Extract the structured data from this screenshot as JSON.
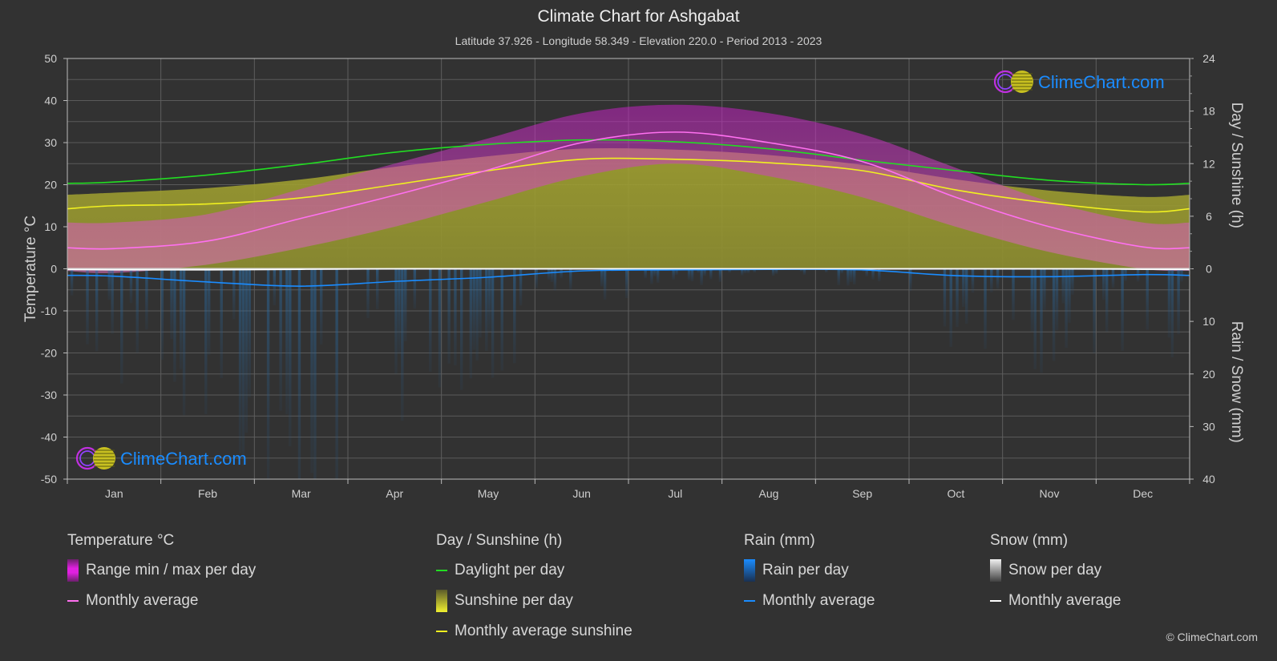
{
  "header": {
    "title": "Climate Chart for Ashgabat",
    "subtitle": "Latitude 37.926 - Longitude 58.349 - Elevation 220.0 - Period 2013 - 2023"
  },
  "watermark": {
    "text": "ClimeChart.com"
  },
  "copyright": "© ClimeChart.com",
  "legend": {
    "temperature": {
      "title": "Temperature °C",
      "items": [
        {
          "label": "Range min / max per day",
          "color": "#e020e0",
          "kind": "box"
        },
        {
          "label": "Monthly average",
          "color": "#ff70f0",
          "kind": "line"
        }
      ]
    },
    "sunshine": {
      "title": "Day / Sunshine (h)",
      "items": [
        {
          "label": "Daylight per day",
          "color": "#22dd22",
          "kind": "line"
        },
        {
          "label": "Sunshine per day",
          "color": "#e8e830",
          "kind": "box"
        },
        {
          "label": "Monthly average sunshine",
          "color": "#f0f020",
          "kind": "line"
        }
      ]
    },
    "rain": {
      "title": "Rain (mm)",
      "items": [
        {
          "label": "Rain per day",
          "color": "#1a8cff",
          "kind": "box"
        },
        {
          "label": "Monthly average",
          "color": "#1a8cff",
          "kind": "line"
        }
      ]
    },
    "snow": {
      "title": "Snow (mm)",
      "items": [
        {
          "label": "Snow per day",
          "color": "#e0e0e0",
          "kind": "box"
        },
        {
          "label": "Monthly average",
          "color": "#ffffff",
          "kind": "line"
        }
      ]
    }
  },
  "chart_data": {
    "type": "line",
    "title": "Climate Chart for Ashgabat",
    "categories": [
      "Jan",
      "Feb",
      "Mar",
      "Apr",
      "May",
      "Jun",
      "Jul",
      "Aug",
      "Sep",
      "Oct",
      "Nov",
      "Dec"
    ],
    "axes": {
      "left": {
        "label": "Temperature °C",
        "range": [
          -50,
          50
        ],
        "ticks": [
          50,
          40,
          30,
          20,
          10,
          0,
          -10,
          -20,
          -30,
          -40,
          -50
        ]
      },
      "right_top": {
        "label": "Day / Sunshine (h)",
        "range": [
          0,
          24
        ],
        "ticks": [
          24,
          18,
          12,
          6,
          0
        ]
      },
      "right_bottom": {
        "label": "Rain / Snow (mm)",
        "range": [
          0,
          40
        ],
        "ticks": [
          10,
          20,
          30,
          40
        ]
      }
    },
    "grid": true,
    "legend_position": "bottom",
    "series": [
      {
        "name": "Temperature monthly average",
        "unit": "°C",
        "color": "#ff70f0",
        "values": [
          4.8,
          6.6,
          12.0,
          17.5,
          23.5,
          30.0,
          32.5,
          30.0,
          25.5,
          17.0,
          10.0,
          5.2
        ]
      },
      {
        "name": "Temperature daily max (approx)",
        "unit": "°C",
        "color": "#a020a0",
        "values": [
          11,
          13,
          19,
          25,
          31,
          37,
          39,
          37,
          32,
          24,
          16,
          11
        ]
      },
      {
        "name": "Temperature daily min (approx)",
        "unit": "°C",
        "color": "#a020a0",
        "values": [
          -1,
          1,
          5,
          10,
          16,
          22,
          25,
          22,
          17,
          10,
          4,
          0
        ]
      },
      {
        "name": "Daylight per day",
        "unit": "h",
        "color": "#22dd22",
        "values": [
          9.9,
          10.7,
          11.9,
          13.3,
          14.2,
          14.7,
          14.5,
          13.7,
          12.4,
          11.2,
          10.1,
          9.6
        ]
      },
      {
        "name": "Monthly average sunshine",
        "unit": "h",
        "color": "#f0f020",
        "values": [
          7.2,
          7.4,
          8.1,
          9.6,
          11.2,
          12.5,
          12.5,
          12.1,
          11.2,
          9.0,
          7.5,
          6.5
        ]
      },
      {
        "name": "Rain monthly average",
        "unit": "mm",
        "color": "#1a8cff",
        "values": [
          1.4,
          2.5,
          3.3,
          2.4,
          1.6,
          0.4,
          0.2,
          0.1,
          0.2,
          1.3,
          1.5,
          1.1
        ]
      },
      {
        "name": "Snow monthly average",
        "unit": "mm",
        "color": "#ffffff",
        "values": [
          0.2,
          0.2,
          0.1,
          0,
          0,
          0,
          0,
          0,
          0,
          0,
          0,
          0.1
        ]
      }
    ]
  }
}
